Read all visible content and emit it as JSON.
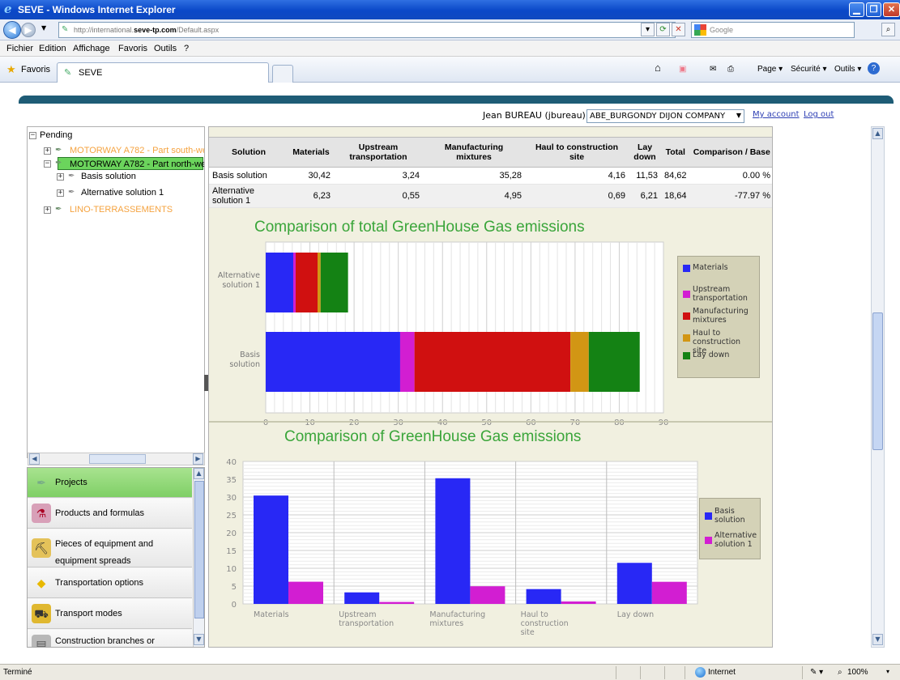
{
  "window": {
    "title": "SEVE - Windows Internet Explorer",
    "url_prefix": "http://international.",
    "url_domain": "seve-tp.com",
    "url_path": "/Default.aspx",
    "search_placeholder": "Google"
  },
  "menu": [
    "Fichier",
    "Edition",
    "Affichage",
    "Favoris",
    "Outils",
    "?"
  ],
  "favorites": {
    "label": "Favoris",
    "tab": "SEVE"
  },
  "commands": [
    "Page ▾",
    "Sécurité ▾",
    "Outils ▾"
  ],
  "header": {
    "user": "Jean BUREAU (jbureau)",
    "company": "ABE_BURGONDY DIJON COMPANY",
    "my_account": "My account",
    "logout": "Log out"
  },
  "tree": {
    "root": "Pending",
    "nodes": [
      "MOTORWAY A782 - Part south-wes",
      "MOTORWAY A782 - Part north-wes",
      "Basis solution",
      "Alternative solution 1",
      "LINO-TERRASSEMENTS"
    ]
  },
  "nav": [
    "Projects",
    "Products and formulas",
    "Pieces of equipment and",
    "equipment spreads",
    "Transportation options",
    "Transport modes",
    "Construction branches or"
  ],
  "table": {
    "headers": [
      "Solution",
      "Materials",
      "Upstream transportation",
      "Manufacturing mixtures",
      "Haul to construction site",
      "Lay down",
      "Total",
      "Comparison / Base"
    ],
    "rows": [
      [
        "Basis solution",
        "30,42",
        "3,24",
        "35,28",
        "4,16",
        "11,53",
        "84,62",
        "0.00 %"
      ],
      [
        "Alternative solution 1",
        "6,23",
        "0,55",
        "4,95",
        "0,69",
        "6,21",
        "18,64",
        "-77.97 %"
      ]
    ]
  },
  "chart_data": [
    {
      "type": "bar",
      "orientation": "horizontal",
      "stacked": true,
      "title": "Comparison of total GreenHouse Gas emissions",
      "categories": [
        "Alternative solution 1",
        "Basis solution"
      ],
      "series": [
        {
          "name": "Materials",
          "color": "#2828f5",
          "values": [
            6.23,
            30.42
          ]
        },
        {
          "name": "Upstream transportation",
          "color": "#d21ed2",
          "values": [
            0.55,
            3.24
          ]
        },
        {
          "name": "Manufacturing mixtures",
          "color": "#d01010",
          "values": [
            4.95,
            35.28
          ]
        },
        {
          "name": "Haul to construction site",
          "color": "#d29614",
          "values": [
            0.69,
            4.16
          ]
        },
        {
          "name": "Lay down",
          "color": "#148214",
          "values": [
            6.21,
            11.53
          ]
        }
      ],
      "xlim": [
        0,
        90
      ],
      "xticks": [
        0,
        10,
        20,
        30,
        40,
        50,
        60,
        70,
        80,
        90
      ],
      "grid": true,
      "legend": "right"
    },
    {
      "type": "bar",
      "title": "Comparison of GreenHouse Gas emissions",
      "categories": [
        "Materials",
        "Upstream transportation",
        "Manufacturing mixtures",
        "Haul to construction site",
        "Lay down"
      ],
      "series": [
        {
          "name": "Basis solution",
          "color": "#2828f5",
          "values": [
            30.42,
            3.24,
            35.28,
            4.16,
            11.53
          ]
        },
        {
          "name": "Alternative solution 1",
          "color": "#d21ed2",
          "values": [
            6.23,
            0.55,
            4.95,
            0.69,
            6.21
          ]
        }
      ],
      "ylim": [
        0,
        40
      ],
      "yticks": [
        0,
        5,
        10,
        15,
        20,
        25,
        30,
        35,
        40
      ],
      "grid": true,
      "legend": "right"
    }
  ],
  "status": {
    "left": "Terminé",
    "zone": "Internet",
    "zoom": "100%"
  }
}
